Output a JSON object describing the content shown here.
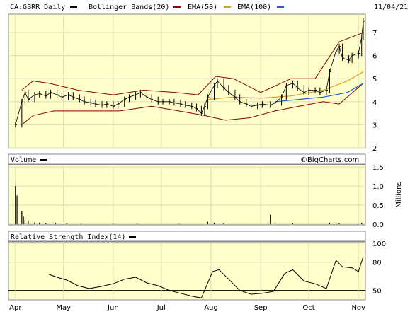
{
  "header": {
    "symbol": "CA:GBRR Daily",
    "date": "11/04/21",
    "legend": [
      {
        "name": "Bollinger Bands(20)",
        "color": "#000000"
      },
      {
        "name": "EMA(50)",
        "color": "#8b0000"
      },
      {
        "name": "EMA(100)",
        "color": "#d4a017"
      },
      {
        "name": "",
        "color": "#1f5fd6"
      }
    ]
  },
  "watermark": "©BigCharts.com",
  "colors": {
    "panel_bg": "#ffffcc",
    "price_bars": "#000000",
    "bollinger": "#8b0000",
    "ema50": "#d4a017",
    "ema100": "#1f5fd6",
    "volume": "#000000",
    "rsi": "#000000"
  },
  "x_axis": {
    "months": [
      "Apr",
      "May",
      "Jun",
      "Jul",
      "Aug",
      "Sep",
      "Oct",
      "Nov"
    ]
  },
  "chart_data": [
    {
      "type": "line",
      "title": "CA:GBRR Daily",
      "ylim": [
        2,
        7.8
      ],
      "yticks": [
        "2",
        "3",
        "4",
        "5",
        "6",
        "7"
      ],
      "grid": true,
      "legend_position": "top",
      "x_domain": [
        "2021-03-29",
        "2021-11-04"
      ],
      "series": [
        {
          "name": "Price",
          "points": [
            [
              "2021-04-01",
              3.0
            ],
            [
              "2021-04-05",
              4.0
            ],
            [
              "2021-04-07",
              4.4
            ],
            [
              "2021-04-09",
              4.1
            ],
            [
              "2021-04-13",
              4.3
            ],
            [
              "2021-04-16",
              4.35
            ],
            [
              "2021-04-20",
              4.25
            ],
            [
              "2021-04-23",
              4.4
            ],
            [
              "2021-04-27",
              4.3
            ],
            [
              "2021-04-30",
              4.2
            ],
            [
              "2021-05-04",
              4.3
            ],
            [
              "2021-05-07",
              4.2
            ],
            [
              "2021-05-11",
              4.1
            ],
            [
              "2021-05-14",
              4.0
            ],
            [
              "2021-05-18",
              3.95
            ],
            [
              "2021-05-21",
              3.9
            ],
            [
              "2021-05-25",
              3.85
            ],
            [
              "2021-05-28",
              3.9
            ],
            [
              "2021-06-01",
              3.8
            ],
            [
              "2021-06-04",
              3.9
            ],
            [
              "2021-06-08",
              4.1
            ],
            [
              "2021-06-11",
              4.2
            ],
            [
              "2021-06-15",
              4.3
            ],
            [
              "2021-06-18",
              4.4
            ],
            [
              "2021-06-22",
              4.2
            ],
            [
              "2021-06-25",
              4.1
            ],
            [
              "2021-06-29",
              4.0
            ],
            [
              "2021-07-02",
              4.0
            ],
            [
              "2021-07-06",
              4.0
            ],
            [
              "2021-07-09",
              3.95
            ],
            [
              "2021-07-13",
              3.9
            ],
            [
              "2021-07-16",
              3.85
            ],
            [
              "2021-07-20",
              3.8
            ],
            [
              "2021-07-23",
              3.7
            ],
            [
              "2021-07-26",
              3.5
            ],
            [
              "2021-07-28",
              3.8
            ],
            [
              "2021-07-30",
              4.2
            ],
            [
              "2021-08-03",
              4.7
            ],
            [
              "2021-08-05",
              4.9
            ],
            [
              "2021-08-09",
              4.6
            ],
            [
              "2021-08-12",
              4.4
            ],
            [
              "2021-08-16",
              4.2
            ],
            [
              "2021-08-19",
              4.0
            ],
            [
              "2021-08-23",
              3.9
            ],
            [
              "2021-08-26",
              3.8
            ],
            [
              "2021-08-30",
              3.85
            ],
            [
              "2021-09-02",
              3.9
            ],
            [
              "2021-09-07",
              3.85
            ],
            [
              "2021-09-10",
              3.95
            ],
            [
              "2021-09-14",
              4.2
            ],
            [
              "2021-09-17",
              4.7
            ],
            [
              "2021-09-21",
              4.8
            ],
            [
              "2021-09-24",
              4.6
            ],
            [
              "2021-09-28",
              4.4
            ],
            [
              "2021-10-01",
              4.5
            ],
            [
              "2021-10-05",
              4.5
            ],
            [
              "2021-10-08",
              4.4
            ],
            [
              "2021-10-12",
              4.5
            ],
            [
              "2021-10-14",
              5.3
            ],
            [
              "2021-10-18",
              6.2
            ],
            [
              "2021-10-20",
              6.4
            ],
            [
              "2021-10-22",
              5.9
            ],
            [
              "2021-10-26",
              5.8
            ],
            [
              "2021-10-28",
              6.0
            ],
            [
              "2021-11-01",
              6.1
            ],
            [
              "2021-11-03",
              6.8
            ],
            [
              "2021-11-04",
              7.5
            ]
          ]
        },
        {
          "name": "Bollinger Upper",
          "points": [
            [
              "2021-04-05",
              4.5
            ],
            [
              "2021-04-12",
              4.9
            ],
            [
              "2021-04-22",
              4.8
            ],
            [
              "2021-05-10",
              4.5
            ],
            [
              "2021-06-01",
              4.3
            ],
            [
              "2021-06-20",
              4.5
            ],
            [
              "2021-07-10",
              4.4
            ],
            [
              "2021-07-24",
              4.3
            ],
            [
              "2021-08-04",
              5.1
            ],
            [
              "2021-08-15",
              5.0
            ],
            [
              "2021-09-01",
              4.4
            ],
            [
              "2021-09-20",
              5.0
            ],
            [
              "2021-10-05",
              5.0
            ],
            [
              "2021-10-20",
              6.6
            ],
            [
              "2021-11-04",
              7.0
            ]
          ]
        },
        {
          "name": "Bollinger Lower",
          "points": [
            [
              "2021-04-05",
              3.0
            ],
            [
              "2021-04-12",
              3.4
            ],
            [
              "2021-04-25",
              3.6
            ],
            [
              "2021-05-15",
              3.6
            ],
            [
              "2021-06-05",
              3.6
            ],
            [
              "2021-06-25",
              3.8
            ],
            [
              "2021-07-20",
              3.5
            ],
            [
              "2021-07-28",
              3.4
            ],
            [
              "2021-08-10",
              3.2
            ],
            [
              "2021-08-25",
              3.3
            ],
            [
              "2021-09-10",
              3.6
            ],
            [
              "2021-09-25",
              3.8
            ],
            [
              "2021-10-10",
              4.0
            ],
            [
              "2021-10-20",
              3.9
            ],
            [
              "2021-11-04",
              4.8
            ]
          ]
        },
        {
          "name": "EMA(50)",
          "points": [
            [
              "2021-07-30",
              4.1
            ],
            [
              "2021-08-15",
              4.2
            ],
            [
              "2021-09-01",
              4.15
            ],
            [
              "2021-09-20",
              4.25
            ],
            [
              "2021-10-10",
              4.5
            ],
            [
              "2021-10-25",
              4.9
            ],
            [
              "2021-11-04",
              5.3
            ]
          ]
        },
        {
          "name": "EMA(100)",
          "points": [
            [
              "2021-09-10",
              4.0
            ],
            [
              "2021-09-25",
              4.1
            ],
            [
              "2021-10-10",
              4.2
            ],
            [
              "2021-10-25",
              4.4
            ],
            [
              "2021-11-04",
              4.8
            ]
          ]
        }
      ]
    },
    {
      "type": "bar",
      "title": "Volume",
      "ylabel": "Millions",
      "ylim": [
        0,
        1.5
      ],
      "yticks": [
        "0.0",
        "0.5",
        "1.0",
        "1.5"
      ],
      "series": [
        {
          "name": "Volume",
          "points": [
            [
              "2021-04-01",
              1.0
            ],
            [
              "2021-04-02",
              0.75
            ],
            [
              "2021-04-05",
              0.35
            ],
            [
              "2021-04-06",
              0.2
            ],
            [
              "2021-04-07",
              0.12
            ],
            [
              "2021-04-09",
              0.1
            ],
            [
              "2021-04-13",
              0.05
            ],
            [
              "2021-04-16",
              0.04
            ],
            [
              "2021-04-20",
              0.03
            ],
            [
              "2021-04-26",
              0.02
            ],
            [
              "2021-05-03",
              0.02
            ],
            [
              "2021-05-12",
              0.01
            ],
            [
              "2021-06-01",
              0.01
            ],
            [
              "2021-06-16",
              0.01
            ],
            [
              "2021-07-12",
              0.01
            ],
            [
              "2021-07-30",
              0.06
            ],
            [
              "2021-08-03",
              0.04
            ],
            [
              "2021-08-09",
              0.02
            ],
            [
              "2021-09-07",
              0.25
            ],
            [
              "2021-09-10",
              0.05
            ],
            [
              "2021-09-21",
              0.03
            ],
            [
              "2021-10-14",
              0.04
            ],
            [
              "2021-10-18",
              0.05
            ],
            [
              "2021-10-20",
              0.03
            ],
            [
              "2021-11-03",
              0.04
            ]
          ]
        }
      ]
    },
    {
      "type": "line",
      "title": "Relative Strength Index(14)",
      "ylim": [
        40,
        100
      ],
      "yticks": [
        "50",
        "80",
        "100"
      ],
      "reference_line": 50,
      "series": [
        {
          "name": "RSI",
          "points": [
            [
              "2021-04-22",
              67
            ],
            [
              "2021-04-27",
              64
            ],
            [
              "2021-05-03",
              61
            ],
            [
              "2021-05-10",
              55
            ],
            [
              "2021-05-17",
              52
            ],
            [
              "2021-05-24",
              54
            ],
            [
              "2021-06-01",
              57
            ],
            [
              "2021-06-08",
              62
            ],
            [
              "2021-06-15",
              64
            ],
            [
              "2021-06-22",
              58
            ],
            [
              "2021-06-29",
              55
            ],
            [
              "2021-07-06",
              50
            ],
            [
              "2021-07-13",
              47
            ],
            [
              "2021-07-20",
              44
            ],
            [
              "2021-07-26",
              42
            ],
            [
              "2021-08-02",
              70
            ],
            [
              "2021-08-06",
              72
            ],
            [
              "2021-08-12",
              62
            ],
            [
              "2021-08-19",
              50
            ],
            [
              "2021-08-26",
              46
            ],
            [
              "2021-09-02",
              47
            ],
            [
              "2021-09-09",
              49
            ],
            [
              "2021-09-16",
              68
            ],
            [
              "2021-09-21",
              72
            ],
            [
              "2021-09-28",
              60
            ],
            [
              "2021-10-05",
              57
            ],
            [
              "2021-10-12",
              52
            ],
            [
              "2021-10-18",
              82
            ],
            [
              "2021-10-22",
              75
            ],
            [
              "2021-10-28",
              74
            ],
            [
              "2021-11-01",
              70
            ],
            [
              "2021-11-04",
              86
            ]
          ]
        }
      ]
    }
  ]
}
